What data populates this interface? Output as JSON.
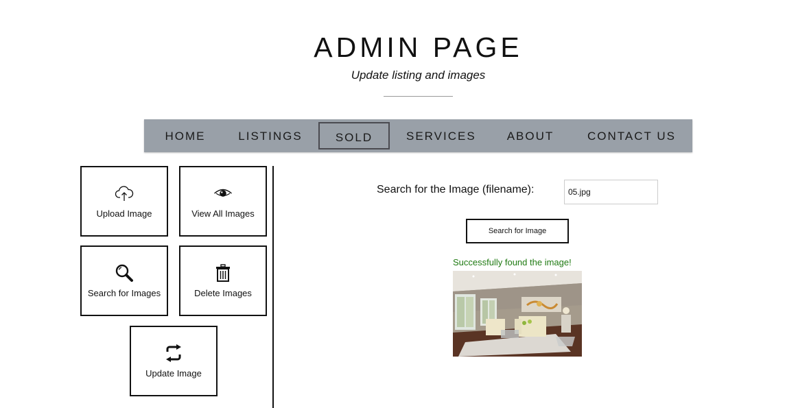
{
  "header": {
    "title": "ADMIN PAGE",
    "subtitle": "Update listing and images"
  },
  "nav": {
    "items": [
      {
        "label": "HOME",
        "active": false
      },
      {
        "label": "LISTINGS",
        "active": false
      },
      {
        "label": "SOLD",
        "active": true
      },
      {
        "label": "SERVICES",
        "active": false
      },
      {
        "label": "ABOUT",
        "active": false
      },
      {
        "label": "CONTACT US",
        "active": false
      }
    ]
  },
  "sidebar": {
    "tiles": [
      {
        "label": "Upload Image",
        "icon": "cloud-upload-icon"
      },
      {
        "label": "View All Images",
        "icon": "eye-icon"
      },
      {
        "label": "Search for Images",
        "icon": "magnifier-icon"
      },
      {
        "label": "Delete Images",
        "icon": "trash-icon"
      },
      {
        "label": "Update Image",
        "icon": "refresh-icon"
      }
    ]
  },
  "search": {
    "label": "Search for the Image (filename):",
    "value": "05.jpg",
    "button_label": "Search for Image",
    "success_message": "Successfully found the image!"
  },
  "colors": {
    "nav_background": "#99a0a8",
    "success_text": "#1f7a12"
  }
}
